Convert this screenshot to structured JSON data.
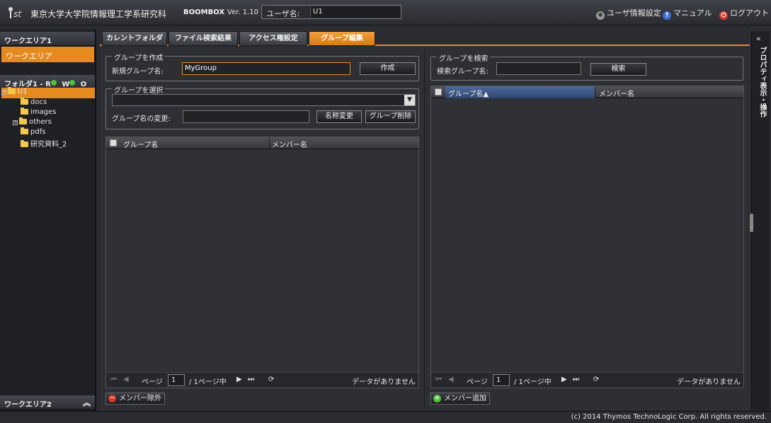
{
  "header": {
    "university": "東京大学大学院情報理工学系研究科",
    "app_name": "BOOMBOX",
    "version": "Ver. 1.10",
    "user_label": "ユーザ名:",
    "user_value": "U1",
    "links": {
      "user_settings": "ユーザ情報設定",
      "manual": "マニュアル",
      "logout": "ログアウト"
    }
  },
  "left": {
    "workarea1_title": "ワークエリア1",
    "workarea_item": "ワークエリア",
    "folder_title": "フォルダ1 - R",
    "perm_w": "W",
    "perm_o": "O",
    "tree": [
      "U1",
      "docs",
      "images",
      "others",
      "pdfs",
      "研究資料_2"
    ],
    "workarea2_title": "ワークエリア2"
  },
  "tabs": [
    "カレントフォルダ",
    "ファイル検索結果",
    "アクセス権設定",
    "グループ編集"
  ],
  "create_group": {
    "legend": "グループを作成",
    "label": "新規グループ名:",
    "value": "MyGroup",
    "button": "作成"
  },
  "select_group": {
    "legend": "グループを選択",
    "rename_label": "グループ名の変更:",
    "rename_button": "名称変更",
    "delete_button": "グループ削除"
  },
  "left_grid": {
    "col_group": "グループ名",
    "col_member": "メンバー名",
    "page_label": "ページ",
    "page_value": "1",
    "page_of": "/ 1ページ中",
    "no_data": "データがありません",
    "action_button": "メンバー除外"
  },
  "search_group": {
    "legend": "グループを検索",
    "label": "検索グループ名:",
    "value": "",
    "button": "検索"
  },
  "right_grid": {
    "col_group": "グループ名▲",
    "col_member": "メンバー名",
    "page_label": "ページ",
    "page_value": "1",
    "page_of": "/ 1ページ中",
    "no_data": "データがありません",
    "action_button": "メンバー追加"
  },
  "right_sidebar": {
    "label": "プロパティ表示・操作"
  },
  "footer": {
    "copyright": "(c) 2014 Thymos TechnoLogic Corp. All rights reserved."
  },
  "colors": {
    "accent": "#e58a1f",
    "background": "#2d2f35",
    "success": "#52c23a",
    "danger": "#d83a2a",
    "info": "#3f6fd8"
  }
}
